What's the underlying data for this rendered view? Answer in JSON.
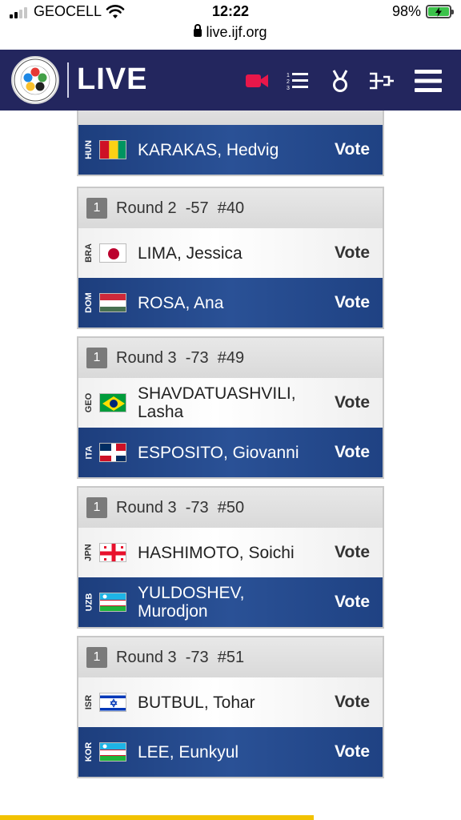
{
  "status_bar": {
    "carrier": "GEOCELL",
    "time": "12:22",
    "battery": "98%",
    "url": "live.ijf.org"
  },
  "header": {
    "title": "LIVE",
    "icons": [
      "video-camera-icon",
      "ranked-list-icon",
      "medal-icon",
      "bracket-icon",
      "hamburger-menu-icon"
    ],
    "accent_color": "#e8174a",
    "background_color": "#23265e"
  },
  "matches": [
    {
      "round_num": "",
      "round_text": "",
      "competitors": [
        {
          "country": "HUN",
          "flag_icon": "guinea-flag-icon",
          "name": "KARAKAS, Hedvig",
          "vote_label": "Vote",
          "style": "blue"
        }
      ]
    },
    {
      "round_num": "1",
      "round_text": "Round 2  -57  #40",
      "competitors": [
        {
          "country": "BRA",
          "flag_icon": "japan-flag-icon",
          "name": "LIMA, Jessica",
          "vote_label": "Vote",
          "style": "white"
        },
        {
          "country": "DOM",
          "flag_icon": "hungary-flag-icon",
          "name": "ROSA, Ana",
          "vote_label": "Vote",
          "style": "blue"
        }
      ]
    },
    {
      "round_num": "1",
      "round_text": "Round 3  -73  #49",
      "competitors": [
        {
          "country": "GEO",
          "flag_icon": "brazil-flag-icon",
          "name": "SHAVDATUASHVILI, Lasha",
          "vote_label": "Vote",
          "style": "white"
        },
        {
          "country": "ITA",
          "flag_icon": "dominican-republic-flag-icon",
          "name": "ESPOSITO, Giovanni",
          "vote_label": "Vote",
          "style": "blue"
        }
      ]
    },
    {
      "round_num": "1",
      "round_text": "Round 3  -73  #50",
      "competitors": [
        {
          "country": "JPN",
          "flag_icon": "georgia-flag-icon",
          "name": "HASHIMOTO, Soichi",
          "vote_label": "Vote",
          "style": "white"
        },
        {
          "country": "UZB",
          "flag_icon": "uzbekistan-flag-icon",
          "name": "YULDOSHEV, Murodjon",
          "vote_label": "Vote",
          "style": "blue"
        }
      ]
    },
    {
      "round_num": "1",
      "round_text": "Round 3  -73  #51",
      "competitors": [
        {
          "country": "ISR",
          "flag_icon": "israel-flag-icon",
          "name": "BUTBUL, Tohar",
          "vote_label": "Vote",
          "style": "white"
        },
        {
          "country": "KOR",
          "flag_icon": "uzbekistan-flag-icon",
          "name": "LEE, Eunkyul",
          "vote_label": "Vote",
          "style": "blue"
        }
      ]
    }
  ]
}
